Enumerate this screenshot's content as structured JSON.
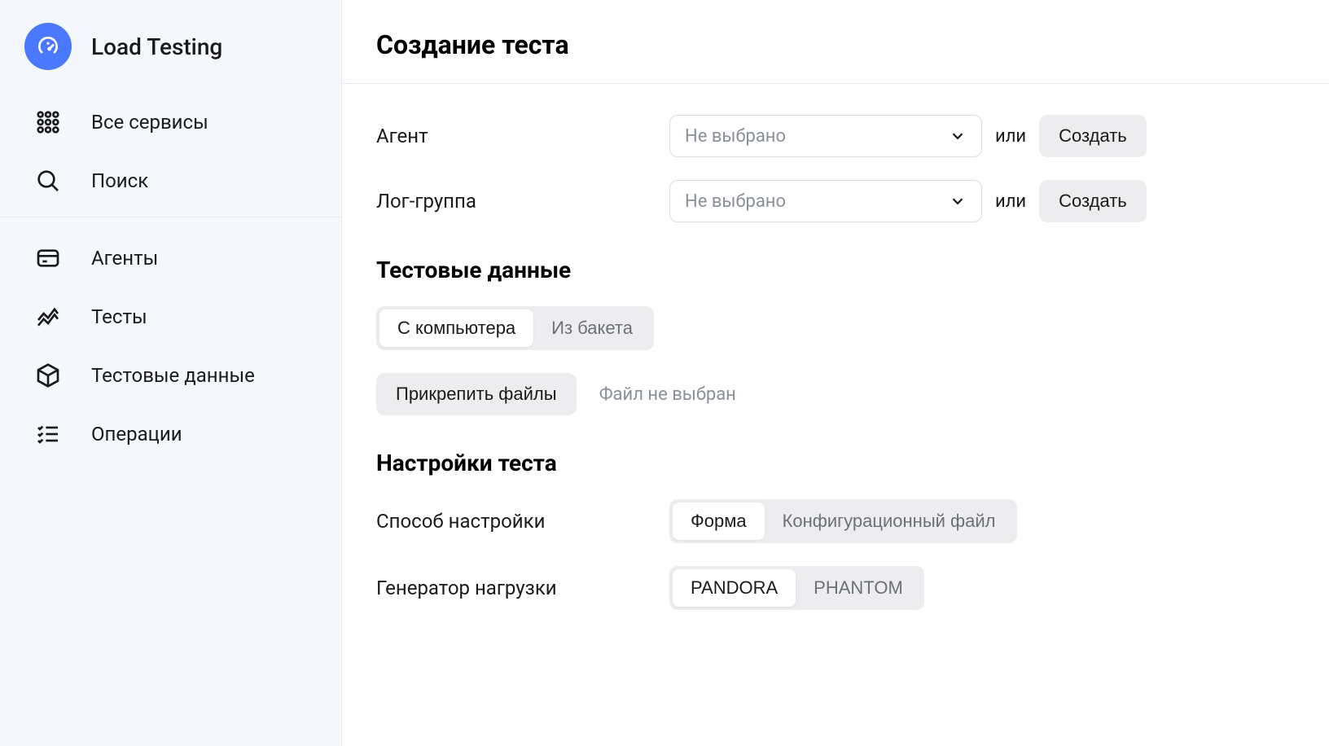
{
  "sidebar": {
    "brand": "Load Testing",
    "all_services": "Все сервисы",
    "search": "Поиск",
    "nav": {
      "agents": "Агенты",
      "tests": "Тесты",
      "test_data": "Тестовые данные",
      "operations": "Операции"
    }
  },
  "page": {
    "title": "Создание теста"
  },
  "form": {
    "agent_label": "Агент",
    "log_group_label": "Лог-группа",
    "select_placeholder": "Не выбрано",
    "or": "или",
    "create_btn": "Создать"
  },
  "test_data": {
    "header": "Тестовые данные",
    "tab_computer": "С компьютера",
    "tab_bucket": "Из бакета",
    "attach_btn": "Прикрепить файлы",
    "no_file": "Файл не выбран"
  },
  "settings": {
    "header": "Настройки теста",
    "method_label": "Способ настройки",
    "method_form": "Форма",
    "method_config": "Конфигурационный файл",
    "generator_label": "Генератор нагрузки",
    "gen_pandora": "PANDORA",
    "gen_phantom": "PHANTOM"
  }
}
